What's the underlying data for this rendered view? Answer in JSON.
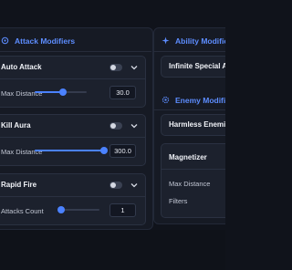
{
  "attack": {
    "title": "Attack Modifiers",
    "icon": "target-icon",
    "cards": [
      {
        "title": "Auto Attack",
        "setting_label": "Max Distance",
        "value": "30.0",
        "slider_fraction": 0.54,
        "enabled": false
      },
      {
        "title": "Kill Aura",
        "setting_label": "Max Distance",
        "value": "300.0",
        "slider_fraction": 1.0,
        "enabled": false
      },
      {
        "title": "Rapid Fire",
        "setting_label": "Attacks Count",
        "value": "1",
        "slider_fraction": 0.0,
        "enabled": false
      }
    ]
  },
  "ability": {
    "title": "Ability Modifiers",
    "icon": "sparkle-icon",
    "cards": [
      {
        "title": "Infinite Special Attack"
      }
    ]
  },
  "enemy": {
    "title": "Enemy Modifiers",
    "icon": "gear-icon",
    "cards": [
      {
        "title": "Harmless Enemies"
      },
      {
        "title": "Magnetizer",
        "rows": [
          "Max Distance",
          "Filters"
        ]
      }
    ]
  },
  "colors": {
    "accent": "#4b82ff",
    "header": "#5d8dff",
    "background": "#10131b",
    "panel": "#161a24",
    "card": "#1c212d"
  }
}
